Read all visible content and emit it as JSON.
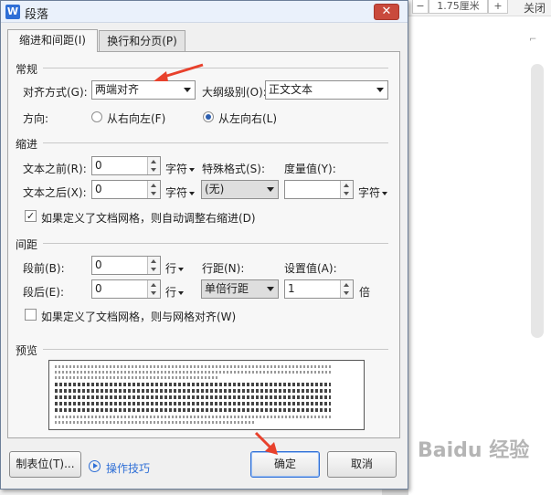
{
  "background": {
    "spin_value": "1.75厘米",
    "minus": "−",
    "plus": "+",
    "close_label": "关闭",
    "corner_mark": "⌐"
  },
  "dialog": {
    "title": "段落",
    "app_icon": "W",
    "close_glyph": "✕",
    "tabs": [
      {
        "label": "缩进和间距(I)",
        "active": true
      },
      {
        "label": "换行和分页(P)",
        "active": false
      }
    ]
  },
  "general": {
    "section": "常规",
    "alignment_label": "对齐方式(G):",
    "alignment_value": "两端对齐",
    "outline_label": "大纲级别(O):",
    "outline_value": "正文文本",
    "direction_label": "方向:",
    "rtl_label": "从右向左(F)",
    "ltr_label": "从左向右(L)",
    "direction_selected": "ltr"
  },
  "indent": {
    "section": "缩进",
    "before_label": "文本之前(R):",
    "before_value": "0",
    "before_unit": "字符",
    "after_label": "文本之后(X):",
    "after_value": "0",
    "after_unit": "字符",
    "special_label": "特殊格式(S):",
    "special_value": "(无)",
    "measure_label": "度量值(Y):",
    "measure_value": "",
    "measure_unit": "字符",
    "grid_check_label": "如果定义了文档网格，则自动调整右缩进(D)",
    "grid_checked": true
  },
  "spacing": {
    "section": "间距",
    "before_label": "段前(B):",
    "before_value": "0",
    "before_unit": "行",
    "after_label": "段后(E):",
    "after_value": "0",
    "after_unit": "行",
    "line_label": "行距(N):",
    "line_value": "单倍行距",
    "setting_label": "设置值(A):",
    "setting_value": "1",
    "setting_unit": "倍",
    "grid_check_label": "如果定义了文档网格，则与网格对齐(W)",
    "grid_checked": false
  },
  "preview": {
    "section": "预览"
  },
  "buttons": {
    "tabs_label": "制表位(T)...",
    "tips_label": "操作技巧",
    "ok_label": "确定",
    "cancel_label": "取消"
  },
  "watermark": "Baidu 经验",
  "colors": {
    "accent": "#2f6fd6",
    "annotation_arrow": "#e8412c"
  }
}
